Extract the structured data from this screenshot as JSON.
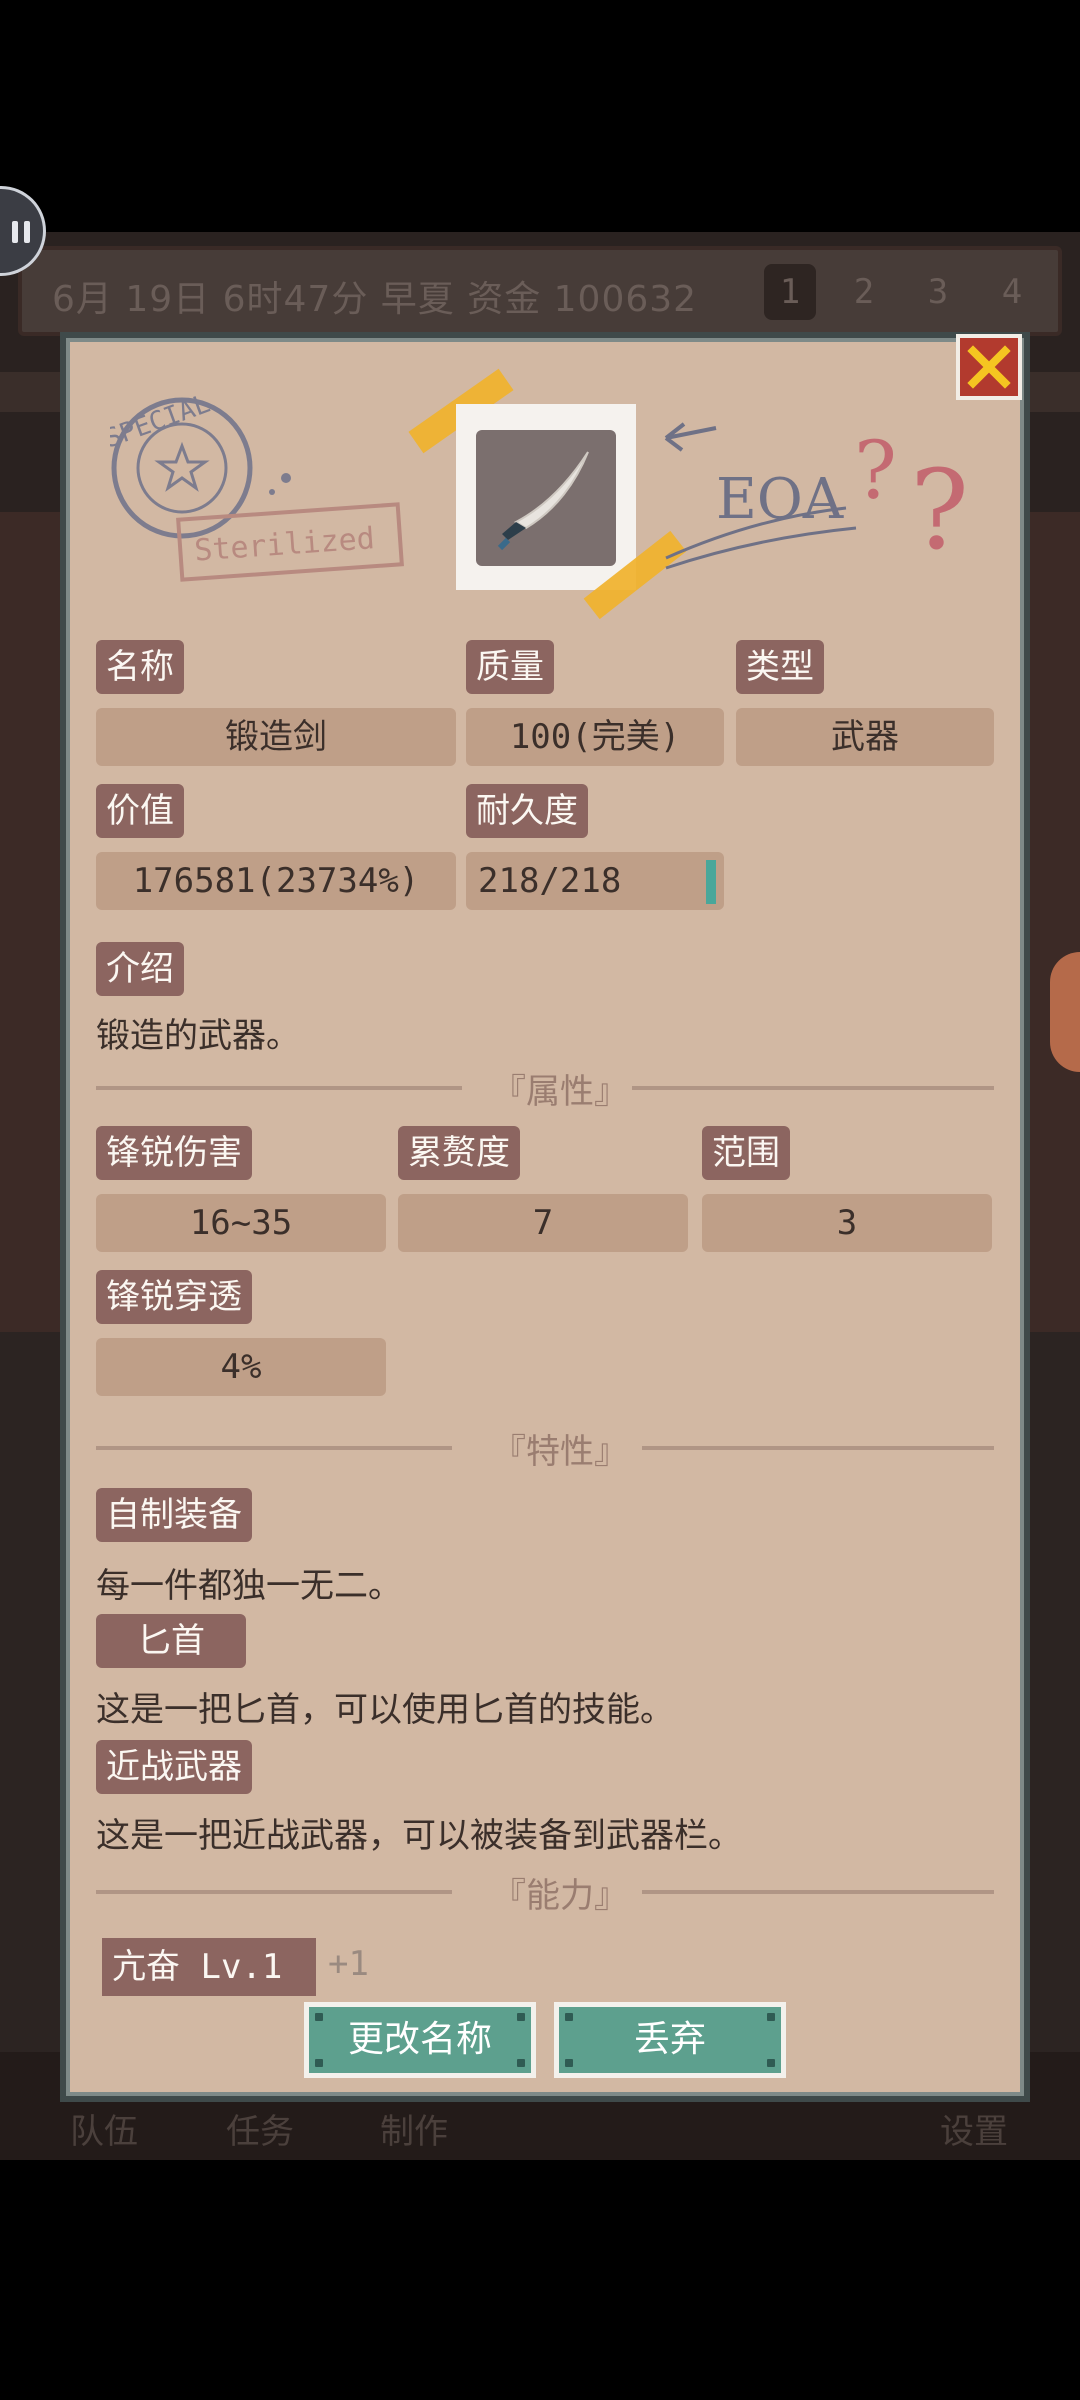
{
  "statusbar": {
    "date_money_text": "6月 19日 6时47分 早夏 资金 100632",
    "pages": [
      "1",
      "2",
      "3",
      "4"
    ]
  },
  "bottom_nav": [
    "队伍",
    "任务",
    "制作",
    "设置"
  ],
  "dialog": {
    "stamp": {
      "text_top": "SPECIAL",
      "text_bottom": "Sterilized"
    },
    "deco_text": "EOA",
    "fields": {
      "name": {
        "label": "名称",
        "value": "锻造剑"
      },
      "quality": {
        "label": "质量",
        "value": "100(完美)"
      },
      "type": {
        "label": "类型",
        "value": "武器"
      },
      "worth": {
        "label": "价值",
        "value": "176581(23734%)"
      },
      "durability": {
        "label": "耐久度",
        "value": "218/218"
      }
    },
    "intro": {
      "label": "介绍",
      "text": "锻造的武器。"
    },
    "attributes": {
      "section_title": "『属性』",
      "items": [
        {
          "label": "锋锐伤害",
          "value": "16~35"
        },
        {
          "label": "累赘度",
          "value": "7"
        },
        {
          "label": "范围",
          "value": "3"
        },
        {
          "label": "锋锐穿透",
          "value": "4%"
        }
      ]
    },
    "traits": {
      "section_title": "『特性』",
      "items": [
        {
          "label": "自制装备",
          "text": "每一件都独一无二。"
        },
        {
          "label": "匕首",
          "text": "这是一把匕首，可以使用匕首的技能。"
        },
        {
          "label": "近战武器",
          "text": "这是一把近战武器，可以被装备到武器栏。"
        }
      ]
    },
    "abilities": {
      "section_title": "『能力』",
      "first": {
        "label": "亢奋 Lv.1",
        "bonus": "+1"
      }
    },
    "buttons": {
      "rename": "更改名称",
      "discard": "丢弃"
    }
  }
}
